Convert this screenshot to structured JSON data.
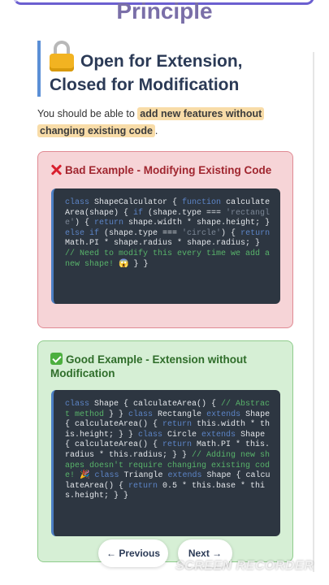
{
  "header": {
    "title": "Principle"
  },
  "headline": {
    "icon": "lock-icon",
    "text": "Open for Extension, Closed for Modification"
  },
  "intro": {
    "prefix": "You should be able to",
    "highlight": "add new features without changing existing code",
    "suffix": "."
  },
  "bad_example": {
    "title": "Bad Example - Modifying Existing Code",
    "icon": "cross-mark-icon",
    "code": [
      {
        "t": "kw",
        "v": "class "
      },
      {
        "t": "tx",
        "v": "ShapeCalculator { "
      },
      {
        "t": "kw",
        "v": "function "
      },
      {
        "t": "tx",
        "v": "calculateArea(shape) { "
      },
      {
        "t": "kw",
        "v": "if "
      },
      {
        "t": "tx",
        "v": "(shape.type === "
      },
      {
        "t": "str",
        "v": "'rectangle'"
      },
      {
        "t": "tx",
        "v": ") { "
      },
      {
        "t": "kw",
        "v": "return "
      },
      {
        "t": "tx",
        "v": "shape.width * shape.height; } "
      },
      {
        "t": "kw",
        "v": "else if "
      },
      {
        "t": "tx",
        "v": "(shape.type === "
      },
      {
        "t": "str",
        "v": "'circle'"
      },
      {
        "t": "tx",
        "v": ") { "
      },
      {
        "t": "kw",
        "v": "return "
      },
      {
        "t": "tx",
        "v": "Math.PI * shape.radius * shape.radius; } "
      },
      {
        "t": "cm",
        "v": "// Need to modify this every time we add a new shape! "
      },
      {
        "t": "tx",
        "v": "😱 } }"
      }
    ]
  },
  "good_example": {
    "title": "Good Example - Extension without Modification",
    "icon": "check-mark-icon",
    "code": [
      {
        "t": "kw",
        "v": "class "
      },
      {
        "t": "tx",
        "v": "Shape { calculateArea() { "
      },
      {
        "t": "cm",
        "v": "// Abstract method "
      },
      {
        "t": "tx",
        "v": "} } "
      },
      {
        "t": "kw",
        "v": "class "
      },
      {
        "t": "tx",
        "v": "Rectangle "
      },
      {
        "t": "kw",
        "v": "extends "
      },
      {
        "t": "tx",
        "v": "Shape { calculateArea() { "
      },
      {
        "t": "kw",
        "v": "return "
      },
      {
        "t": "tx",
        "v": "this.width * this.height; } } "
      },
      {
        "t": "kw",
        "v": "class "
      },
      {
        "t": "tx",
        "v": "Circle "
      },
      {
        "t": "kw",
        "v": "extends "
      },
      {
        "t": "tx",
        "v": "Shape { calculateArea() { "
      },
      {
        "t": "kw",
        "v": "return "
      },
      {
        "t": "tx",
        "v": "Math.PI * this.radius * this.radius; } } "
      },
      {
        "t": "cm",
        "v": "// Adding new shapes doesn't require changing existing code! "
      },
      {
        "t": "tx",
        "v": "🎉 "
      },
      {
        "t": "kw",
        "v": "class "
      },
      {
        "t": "tx",
        "v": "Triangle "
      },
      {
        "t": "kw",
        "v": "extends "
      },
      {
        "t": "tx",
        "v": "Shape { calculateArea() { "
      },
      {
        "t": "kw",
        "v": "return "
      },
      {
        "t": "tx",
        "v": "0.5 * this.base * this.height; } }"
      }
    ]
  },
  "nav": {
    "previous_label": "← Previous",
    "next_label": "Next →"
  },
  "watermark": "SCREEN RECORDER",
  "colors": {
    "bad_bg": "#f6d4d7",
    "good_bg": "#d6efd5",
    "code_bg": "#2d3641",
    "keyword": "#5c84c6",
    "comment": "#58b36a",
    "highlight": "#f8dca8"
  }
}
